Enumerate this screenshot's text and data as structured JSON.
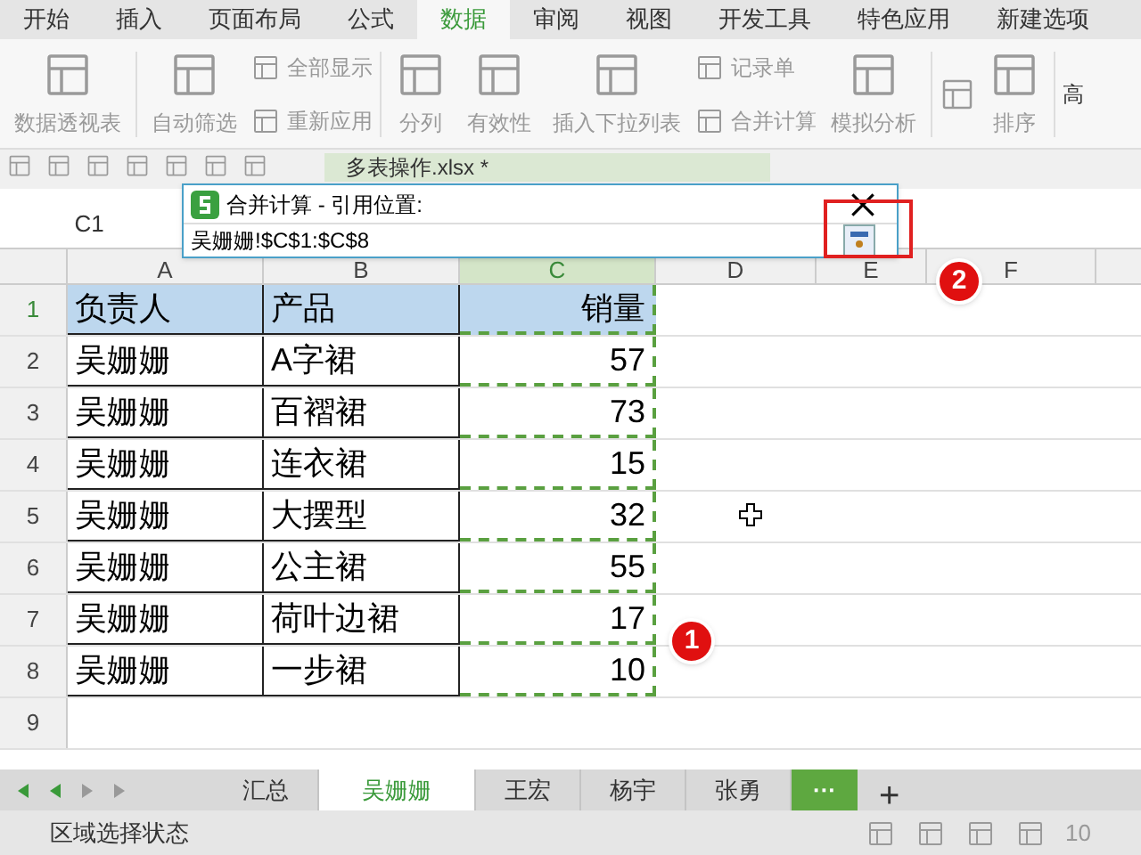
{
  "menu_tabs": [
    {
      "label": "开始",
      "selected": false
    },
    {
      "label": "插入",
      "selected": false
    },
    {
      "label": "页面布局",
      "selected": false
    },
    {
      "label": "公式",
      "selected": false
    },
    {
      "label": "数据",
      "selected": true
    },
    {
      "label": "审阅",
      "selected": false
    },
    {
      "label": "视图",
      "selected": false
    },
    {
      "label": "开发工具",
      "selected": false
    },
    {
      "label": "特色应用",
      "selected": false
    },
    {
      "label": "新建选项",
      "selected": false
    }
  ],
  "ribbon": {
    "pivot": "数据透视表",
    "autofilter": "自动筛选",
    "show_all": "全部显示",
    "reapply": "重新应用",
    "split": "分列",
    "validity": "有效性",
    "dropdown": "插入下拉列表",
    "record": "记录单",
    "consolidate": "合并计算",
    "whatif": "模拟分析",
    "sort": "排序",
    "advanced": "高"
  },
  "document_tab": "多表操作.xlsx *",
  "name_box": "C1",
  "columns": [
    "A",
    "B",
    "C",
    "D",
    "E",
    "F"
  ],
  "rows": [
    {
      "number": "1",
      "cells": [
        "负责人",
        "产品",
        "销量"
      ]
    },
    {
      "number": "2",
      "cells": [
        "吴姗姗",
        "A字裙",
        "57"
      ]
    },
    {
      "number": "3",
      "cells": [
        "吴姗姗",
        "百褶裙",
        "73"
      ]
    },
    {
      "number": "4",
      "cells": [
        "吴姗姗",
        "连衣裙",
        "15"
      ]
    },
    {
      "number": "5",
      "cells": [
        "吴姗姗",
        "大摆型",
        "32"
      ]
    },
    {
      "number": "6",
      "cells": [
        "吴姗姗",
        "公主裙",
        "55"
      ]
    },
    {
      "number": "7",
      "cells": [
        "吴姗姗",
        "荷叶边裙",
        "17"
      ]
    },
    {
      "number": "8",
      "cells": [
        "吴姗姗",
        "一步裙",
        "10"
      ]
    },
    {
      "number": "9",
      "cells": []
    }
  ],
  "dialog": {
    "title": "合并计算 - 引用位置:",
    "value": "吴姗姗!$C$1:$C$8"
  },
  "callouts": [
    "1",
    "2"
  ],
  "sheet_tabs": [
    {
      "label": "汇总",
      "selected": false
    },
    {
      "label": "吴姗姗",
      "selected": true
    },
    {
      "label": "王宏",
      "selected": false
    },
    {
      "label": "杨宇",
      "selected": false
    },
    {
      "label": "张勇",
      "selected": false
    }
  ],
  "more_sheets": "···",
  "add_sheet": "+",
  "status": "区域选择状态",
  "zoom": "10"
}
